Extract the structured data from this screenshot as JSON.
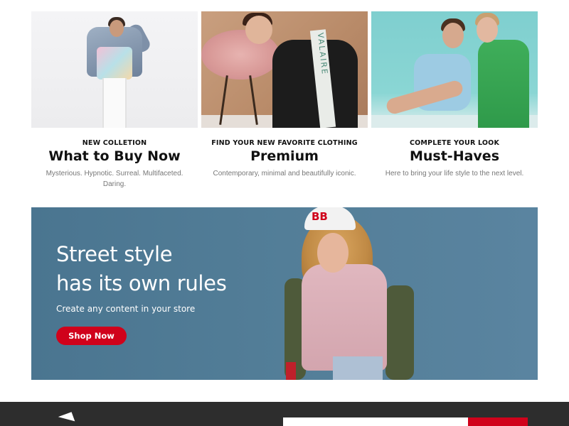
{
  "cards": [
    {
      "eyebrow": "NEW COLLETION",
      "title": "What to Buy Now",
      "description": "Mysterious. Hypnotic. Surreal. Multifaceted. Daring."
    },
    {
      "eyebrow": "FIND YOUR NEW FAVORITE CLOTHING",
      "title": "Premium",
      "description": "Contemporary, minimal and beautifully iconic.",
      "image_text": "VALAIRE"
    },
    {
      "eyebrow": "COMPLETE YOUR LOOK",
      "title": "Must-Haves",
      "description": "Here to bring your life style to the next level."
    }
  ],
  "hero": {
    "title_line1": "Street style",
    "title_line2": "has its own rules",
    "subtitle": "Create any content in your store",
    "button_label": "Shop Now",
    "cap_logo": "BB"
  },
  "footer": {
    "newsletter_placeholder": "",
    "submit_label": ""
  },
  "colors": {
    "accent": "#d0021b",
    "hero_bg": "#537e98",
    "footer_bg": "#2d2d2d"
  }
}
